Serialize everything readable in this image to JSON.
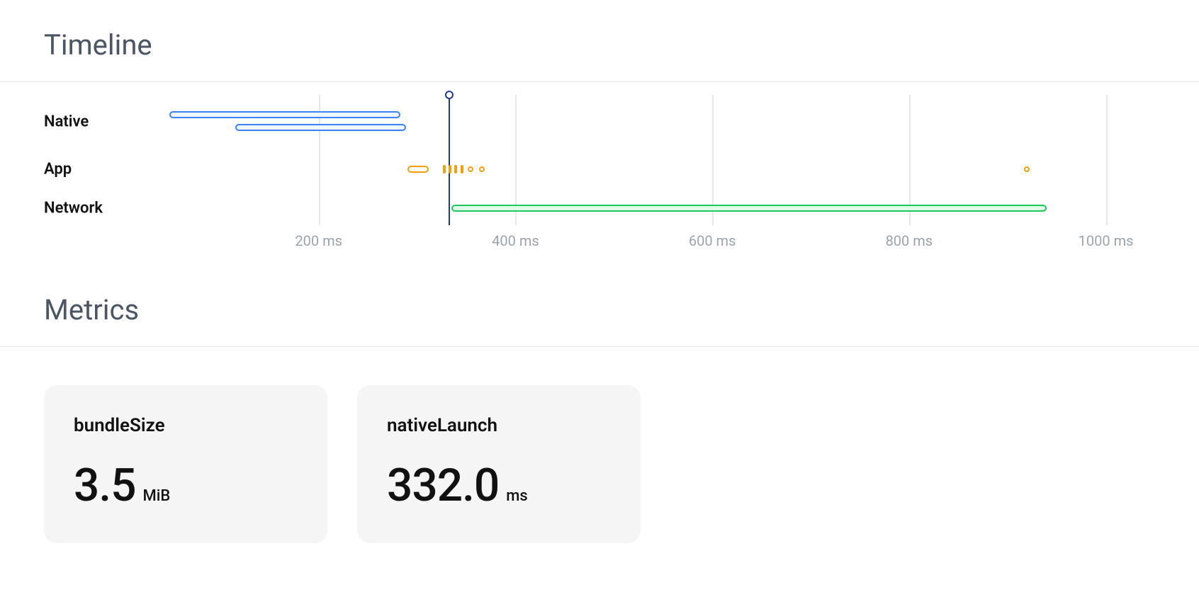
{
  "timeline": {
    "title": "Timeline",
    "rows": [
      "Native",
      "App",
      "Network"
    ],
    "xticks": [
      {
        "ms": 200,
        "label": "200 ms"
      },
      {
        "ms": 400,
        "label": "400 ms"
      },
      {
        "ms": 600,
        "label": "600 ms"
      },
      {
        "ms": 800,
        "label": "800 ms"
      },
      {
        "ms": 1000,
        "label": "1000 ms"
      }
    ]
  },
  "metrics_title": "Metrics",
  "metrics": [
    {
      "name": "bundleSize",
      "value": "3.5",
      "unit": "MiB"
    },
    {
      "name": "nativeLaunch",
      "value": "332.0",
      "unit": "ms"
    }
  ],
  "chart_data": {
    "type": "timeline",
    "xlabel": "",
    "x_unit": "ms",
    "xlim": [
      0,
      1050
    ],
    "marker_at_ms": 332,
    "rows": [
      {
        "name": "Native",
        "bars": [
          {
            "start_ms": 48,
            "end_ms": 283,
            "color": "#3b82f6"
          },
          {
            "start_ms": 115,
            "end_ms": 289,
            "color": "#3b82f6"
          }
        ]
      },
      {
        "name": "App",
        "bars": [
          {
            "start_ms": 290,
            "end_ms": 312,
            "color": "#f59e0b"
          }
        ],
        "ticks": [
          326,
          332,
          338,
          344
        ],
        "points": [
          354,
          366,
          920
        ]
      },
      {
        "name": "Network",
        "bars": [
          {
            "start_ms": 335,
            "end_ms": 940,
            "color": "#22c55e"
          }
        ]
      }
    ],
    "gridlines_ms": [
      200,
      400,
      600,
      800,
      1000
    ]
  }
}
